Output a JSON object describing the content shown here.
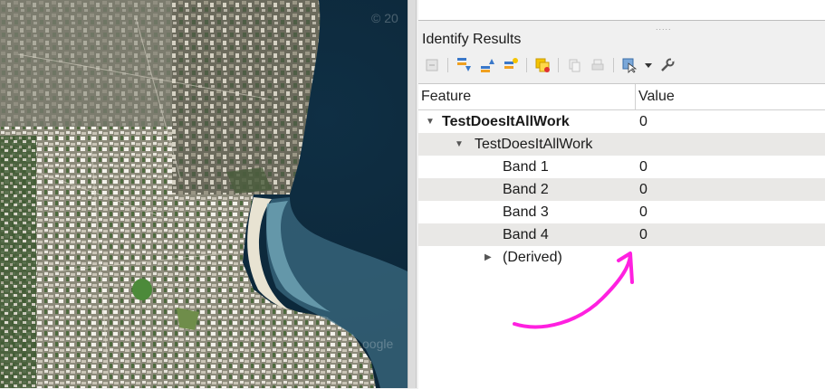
{
  "panel": {
    "title": "Identify Results",
    "columns": {
      "feature": "Feature",
      "value": "Value"
    }
  },
  "tree": {
    "root": {
      "label": "TestDoesItAllWork",
      "value": "0"
    },
    "layer": {
      "label": "TestDoesItAllWork"
    },
    "bands": [
      {
        "label": "Band 1",
        "value": "0"
      },
      {
        "label": "Band 2",
        "value": "0"
      },
      {
        "label": "Band 3",
        "value": "0"
      },
      {
        "label": "Band 4",
        "value": "0"
      }
    ],
    "derived": {
      "label": "(Derived)"
    }
  },
  "annotation_color": "#ff20e0",
  "toolbar_icons": [
    "clear-results-icon",
    "expand-all-icon",
    "collapse-all-icon",
    "expand-new-icon",
    "highlight-icon",
    "copy-icon",
    "print-icon",
    "identify-mode-icon",
    "dropdown-icon",
    "settings-icon"
  ],
  "watermarks": [
    "© 20",
    "oogle"
  ]
}
